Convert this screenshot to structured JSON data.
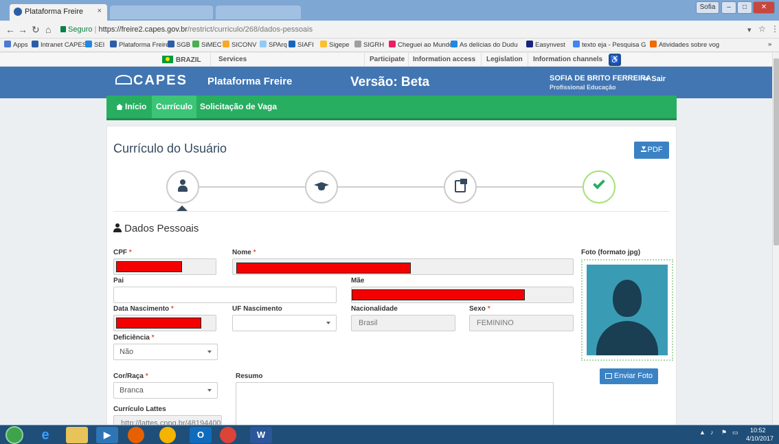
{
  "browser": {
    "tab_title": "Plataforma Freire",
    "tab_close": "×",
    "window_user": "Sofia",
    "url_secure_label": "Seguro",
    "url_host": "https://freire2.capes.gov.br",
    "url_path": "/restrict/curriculo/268/dados-pessoais",
    "bookmarks": [
      "Apps",
      "Intranet CAPES",
      "SEI",
      "Plataforma Freire",
      "SGB",
      "SiMEC",
      "SICONV",
      "SPArq",
      "SIAFI",
      "Sigepe",
      "SIGRH",
      "Cheguei ao Mundo",
      "As delícias do Dudu",
      "Easynvest",
      "texto eja - Pesquisa G",
      "Atividades sobre vog"
    ]
  },
  "gov_bar": {
    "country": "BRAZIL",
    "items": [
      "Services",
      "Participate",
      "Information access",
      "Legislation",
      "Information channels"
    ]
  },
  "header": {
    "logo": "CAPES",
    "platform": "Plataforma Freire",
    "version": "Versão: Beta",
    "user_name": "SOFIA DE BRITO FERREIRA",
    "user_role": "Profissional Educação",
    "logout": "Sair"
  },
  "nav": {
    "items": [
      {
        "label": "Início",
        "active": false
      },
      {
        "label": "Currículo",
        "active": true
      },
      {
        "label": "Solicitação de Vaga",
        "active": false
      }
    ]
  },
  "main": {
    "title": "Currículo do Usuário",
    "pdf_button": "PDF",
    "section_title": "Dados Pessoais",
    "photo_label": "Foto (formato jpg)",
    "photo_button": "Enviar Foto"
  },
  "form": {
    "cpf_label": "CPF",
    "nome_label": "Nome",
    "pai_label": "Pai",
    "mae_label": "Mãe",
    "data_nasc_label": "Data Nascimento",
    "uf_label": "UF Nascimento",
    "nacionalidade_label": "Nacionalidade",
    "nacionalidade_value": "Brasil",
    "sexo_label": "Sexo",
    "sexo_value": "FEMININO",
    "deficiencia_label": "Deficiência",
    "deficiencia_value": "Não",
    "cor_label": "Cor/Raça",
    "cor_value": "Branca",
    "resumo_label": "Resumo",
    "lattes_label": "Currículo Lattes",
    "lattes_value": "http://lattes.cnpq.br/481944003",
    "required_mark": "*"
  },
  "taskbar": {
    "time": "10:52",
    "date": "4/10/2017"
  },
  "colors": {
    "header_blue": "#4176b3",
    "nav_green": "#27ae60",
    "button_blue": "#3b82c4",
    "redaction_red": "#f40000"
  }
}
